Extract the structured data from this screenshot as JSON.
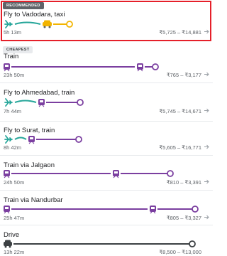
{
  "routes": [
    {
      "badge": "RECOMMENDED",
      "title": "Fly to Vadodara, taxi",
      "duration": "5h 13m",
      "price": "₹5,725 – ₹14,881",
      "icons": [
        "plane-icon",
        "car-icon"
      ]
    },
    {
      "badge": "CHEAPEST",
      "title": "Train",
      "duration": "23h 50m",
      "price": "₹765 – ₹3,177",
      "icons": [
        "train-icon",
        "train-icon"
      ]
    },
    {
      "title": "Fly to Ahmedabad, train",
      "duration": "7h 44m",
      "price": "₹5,745 – ₹14,671",
      "icons": [
        "plane-icon",
        "train-icon"
      ]
    },
    {
      "title": "Fly to Surat, train",
      "duration": "8h 42m",
      "price": "₹5,605 – ₹16,771",
      "icons": [
        "plane-icon",
        "train-icon"
      ]
    },
    {
      "title": "Train via Jalgaon",
      "duration": "24h 50m",
      "price": "₹810 – ₹3,391",
      "icons": [
        "train-icon",
        "train-icon"
      ]
    },
    {
      "title": "Train via Nandurbar",
      "duration": "25h 47m",
      "price": "₹805 – ₹3,327",
      "icons": [
        "train-icon",
        "train-icon"
      ]
    },
    {
      "title": "Drive",
      "duration": "13h 22m",
      "price": "₹8,500 – ₹13,000",
      "icons": [
        "car-icon"
      ]
    }
  ],
  "colors": {
    "flight": "#26a69a",
    "train": "#7b3fa0",
    "car_yellow": "#f2b400",
    "drive": "#3c4043",
    "highlight_border": "#e5202a"
  }
}
